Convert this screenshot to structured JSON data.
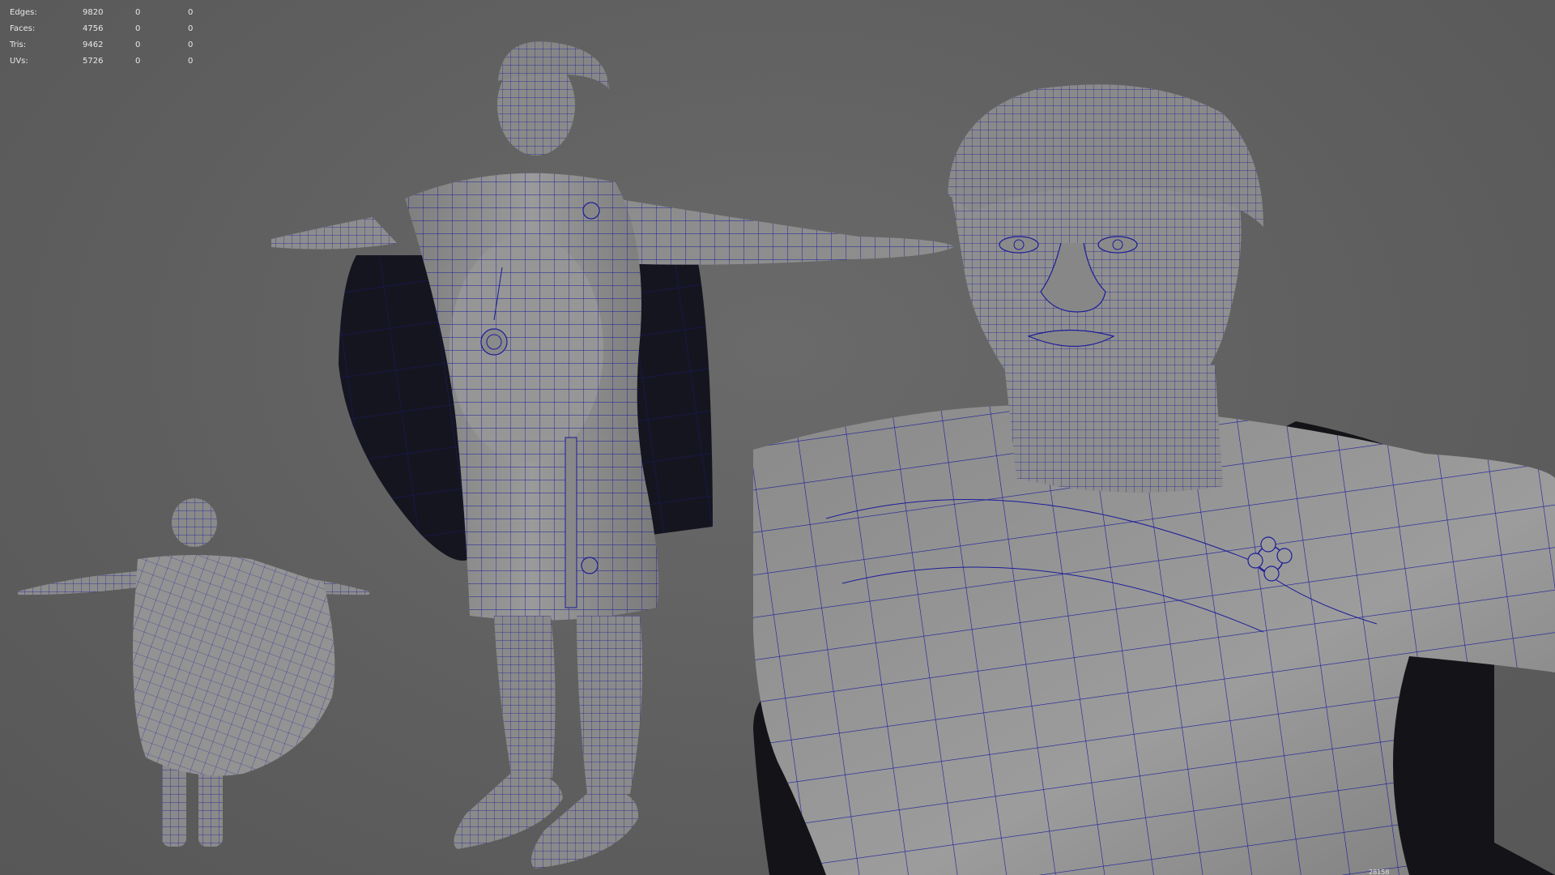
{
  "hud": {
    "rows": [
      {
        "label": "Edges:",
        "value": "9820",
        "selected": "0",
        "component": "0"
      },
      {
        "label": "Faces:",
        "value": "4756",
        "selected": "0",
        "component": "0"
      },
      {
        "label": "Tris:",
        "value": "9462",
        "selected": "0",
        "component": "0"
      },
      {
        "label": "UVs:",
        "value": "5726",
        "selected": "0",
        "component": "0"
      }
    ]
  },
  "colors": {
    "viewport_bg": "#5d5d5d",
    "wireframe": "#1c1c9a",
    "mesh_fill": "#8e8e8e",
    "cape_dark": "#151520"
  },
  "corner_label": "28158"
}
